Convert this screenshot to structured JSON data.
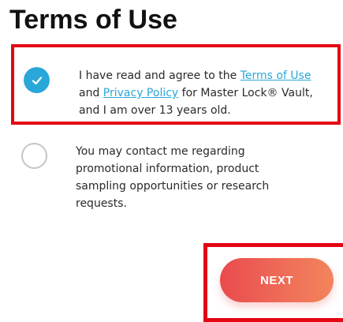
{
  "page": {
    "title": "Terms of Use"
  },
  "agreement": {
    "checked": true,
    "text_before": "I have read and agree to the ",
    "terms_link": "Terms of Use",
    "text_and": " and ",
    "privacy_link": "Privacy Policy",
    "text_after": " for Master Lock® Vault, and I am over 13 years old."
  },
  "contact_consent": {
    "checked": false,
    "text": "You may contact me regarding promotional information, product sampling opportunities or research requests."
  },
  "actions": {
    "next_label": "NEXT"
  },
  "colors": {
    "accent": "#2aa7d9",
    "highlight_border": "#e30613",
    "button_gradient_start": "#e94b4e",
    "button_gradient_end": "#f2845c"
  },
  "icons": {
    "checked_checkbox": "checkmark-icon",
    "unchecked_checkbox": "empty-circle-icon"
  }
}
